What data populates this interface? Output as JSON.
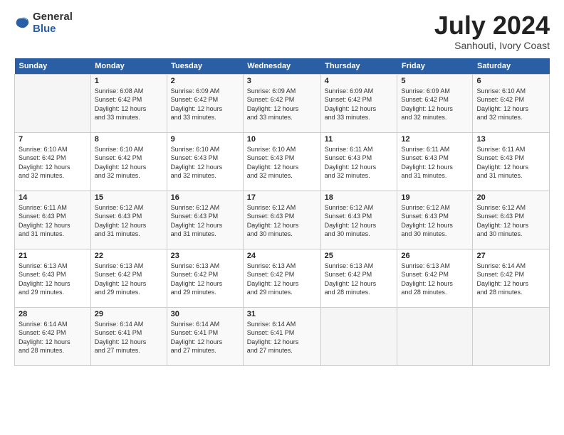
{
  "logo": {
    "general": "General",
    "blue": "Blue"
  },
  "header": {
    "month_year": "July 2024",
    "location": "Sanhouti, Ivory Coast"
  },
  "weekdays": [
    "Sunday",
    "Monday",
    "Tuesday",
    "Wednesday",
    "Thursday",
    "Friday",
    "Saturday"
  ],
  "weeks": [
    [
      {
        "num": "",
        "info": ""
      },
      {
        "num": "1",
        "info": "Sunrise: 6:08 AM\nSunset: 6:42 PM\nDaylight: 12 hours\nand 33 minutes."
      },
      {
        "num": "2",
        "info": "Sunrise: 6:09 AM\nSunset: 6:42 PM\nDaylight: 12 hours\nand 33 minutes."
      },
      {
        "num": "3",
        "info": "Sunrise: 6:09 AM\nSunset: 6:42 PM\nDaylight: 12 hours\nand 33 minutes."
      },
      {
        "num": "4",
        "info": "Sunrise: 6:09 AM\nSunset: 6:42 PM\nDaylight: 12 hours\nand 33 minutes."
      },
      {
        "num": "5",
        "info": "Sunrise: 6:09 AM\nSunset: 6:42 PM\nDaylight: 12 hours\nand 32 minutes."
      },
      {
        "num": "6",
        "info": "Sunrise: 6:10 AM\nSunset: 6:42 PM\nDaylight: 12 hours\nand 32 minutes."
      }
    ],
    [
      {
        "num": "7",
        "info": "Sunrise: 6:10 AM\nSunset: 6:42 PM\nDaylight: 12 hours\nand 32 minutes."
      },
      {
        "num": "8",
        "info": "Sunrise: 6:10 AM\nSunset: 6:42 PM\nDaylight: 12 hours\nand 32 minutes."
      },
      {
        "num": "9",
        "info": "Sunrise: 6:10 AM\nSunset: 6:43 PM\nDaylight: 12 hours\nand 32 minutes."
      },
      {
        "num": "10",
        "info": "Sunrise: 6:10 AM\nSunset: 6:43 PM\nDaylight: 12 hours\nand 32 minutes."
      },
      {
        "num": "11",
        "info": "Sunrise: 6:11 AM\nSunset: 6:43 PM\nDaylight: 12 hours\nand 32 minutes."
      },
      {
        "num": "12",
        "info": "Sunrise: 6:11 AM\nSunset: 6:43 PM\nDaylight: 12 hours\nand 31 minutes."
      },
      {
        "num": "13",
        "info": "Sunrise: 6:11 AM\nSunset: 6:43 PM\nDaylight: 12 hours\nand 31 minutes."
      }
    ],
    [
      {
        "num": "14",
        "info": "Sunrise: 6:11 AM\nSunset: 6:43 PM\nDaylight: 12 hours\nand 31 minutes."
      },
      {
        "num": "15",
        "info": "Sunrise: 6:12 AM\nSunset: 6:43 PM\nDaylight: 12 hours\nand 31 minutes."
      },
      {
        "num": "16",
        "info": "Sunrise: 6:12 AM\nSunset: 6:43 PM\nDaylight: 12 hours\nand 31 minutes."
      },
      {
        "num": "17",
        "info": "Sunrise: 6:12 AM\nSunset: 6:43 PM\nDaylight: 12 hours\nand 30 minutes."
      },
      {
        "num": "18",
        "info": "Sunrise: 6:12 AM\nSunset: 6:43 PM\nDaylight: 12 hours\nand 30 minutes."
      },
      {
        "num": "19",
        "info": "Sunrise: 6:12 AM\nSunset: 6:43 PM\nDaylight: 12 hours\nand 30 minutes."
      },
      {
        "num": "20",
        "info": "Sunrise: 6:12 AM\nSunset: 6:43 PM\nDaylight: 12 hours\nand 30 minutes."
      }
    ],
    [
      {
        "num": "21",
        "info": "Sunrise: 6:13 AM\nSunset: 6:43 PM\nDaylight: 12 hours\nand 29 minutes."
      },
      {
        "num": "22",
        "info": "Sunrise: 6:13 AM\nSunset: 6:42 PM\nDaylight: 12 hours\nand 29 minutes."
      },
      {
        "num": "23",
        "info": "Sunrise: 6:13 AM\nSunset: 6:42 PM\nDaylight: 12 hours\nand 29 minutes."
      },
      {
        "num": "24",
        "info": "Sunrise: 6:13 AM\nSunset: 6:42 PM\nDaylight: 12 hours\nand 29 minutes."
      },
      {
        "num": "25",
        "info": "Sunrise: 6:13 AM\nSunset: 6:42 PM\nDaylight: 12 hours\nand 28 minutes."
      },
      {
        "num": "26",
        "info": "Sunrise: 6:13 AM\nSunset: 6:42 PM\nDaylight: 12 hours\nand 28 minutes."
      },
      {
        "num": "27",
        "info": "Sunrise: 6:14 AM\nSunset: 6:42 PM\nDaylight: 12 hours\nand 28 minutes."
      }
    ],
    [
      {
        "num": "28",
        "info": "Sunrise: 6:14 AM\nSunset: 6:42 PM\nDaylight: 12 hours\nand 28 minutes."
      },
      {
        "num": "29",
        "info": "Sunrise: 6:14 AM\nSunset: 6:41 PM\nDaylight: 12 hours\nand 27 minutes."
      },
      {
        "num": "30",
        "info": "Sunrise: 6:14 AM\nSunset: 6:41 PM\nDaylight: 12 hours\nand 27 minutes."
      },
      {
        "num": "31",
        "info": "Sunrise: 6:14 AM\nSunset: 6:41 PM\nDaylight: 12 hours\nand 27 minutes."
      },
      {
        "num": "",
        "info": ""
      },
      {
        "num": "",
        "info": ""
      },
      {
        "num": "",
        "info": ""
      }
    ]
  ]
}
